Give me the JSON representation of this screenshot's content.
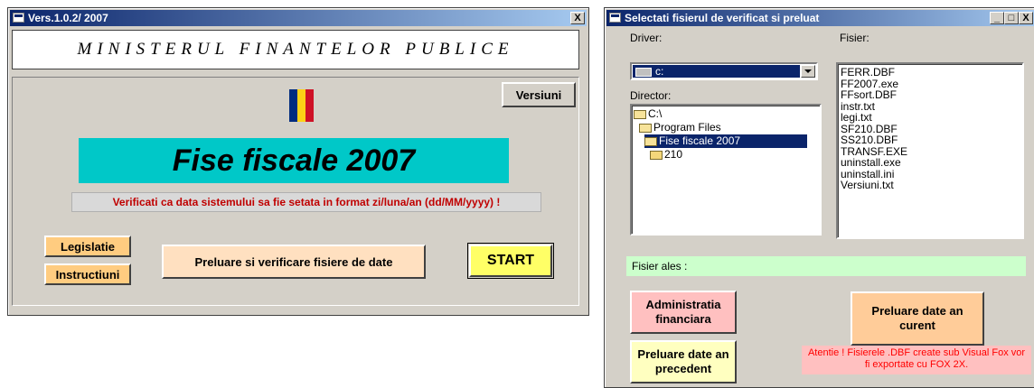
{
  "left_window": {
    "title": "Vers.1.0.2/ 2007",
    "close_glyph": "X",
    "ministry_title": "MINISTERUL FINANTELOR PUBLICE",
    "versions_button": "Versiuni",
    "app_title": "Fise fiscale 2007",
    "notice": "Verificati ca data sistemului sa fie setata in format zi/luna/an (dd/MM/yyyy) !",
    "legislation_button": "Legislatie",
    "instructions_button": "Instructiuni",
    "import_button": "Preluare si verificare fisiere de date",
    "start_button": "START",
    "colors": {
      "flag_blue": "#002b7f",
      "flag_yellow": "#fcd116",
      "flag_red": "#ce1126",
      "title_band": "#00c8c8",
      "notice_text": "#c00000",
      "orange_button": "#ffcc80",
      "start_button": "#ffff66"
    }
  },
  "right_window": {
    "title": "Selectati fisierul de verificat si preluat",
    "minimize_glyph": "_",
    "maximize_glyph": "□",
    "close_glyph": "X",
    "drive_label": "Driver:",
    "drive_value": "c:",
    "directory_label": "Director:",
    "directory_tree": [
      "C:\\",
      "Program Files",
      "Fise fiscale 2007",
      "210"
    ],
    "selected_directory": "Fise fiscale 2007",
    "file_label": "Fisier:",
    "files": [
      "FERR.DBF",
      "FF2007.exe",
      "FFsort.DBF",
      "instr.txt",
      "legi.txt",
      "SF210.DBF",
      "SS210.DBF",
      "TRANSF.EXE",
      "uninstall.exe",
      "uninstall.ini",
      "Versiuni.txt"
    ],
    "selected_file_label": "Fisier ales :",
    "admin_button": "Administratia financiara",
    "previous_year_button": "Preluare date an precedent",
    "current_year_button": "Preluare date an curent",
    "warning": "Atentie ! Fisierele .DBF create sub Visual Fox vor fi exportate cu FOX 2X.",
    "colors": {
      "selected_file_bg": "#ccffcc",
      "admin_button": "#ffc0c0",
      "previous_button": "#ffffc0",
      "current_button": "#ffcc99",
      "warning_bg": "#ffc0c0",
      "warning_text": "#ff0000",
      "selection": "#0a246a"
    }
  }
}
